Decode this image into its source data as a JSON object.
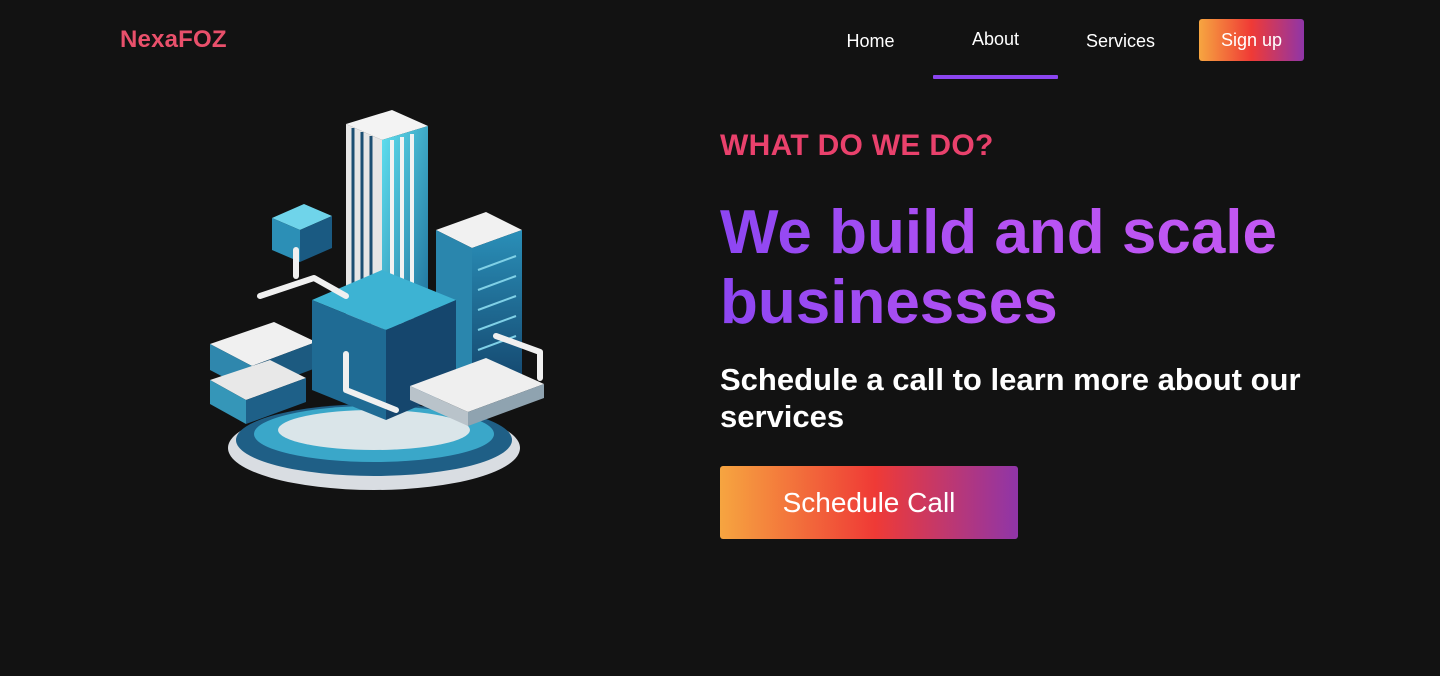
{
  "brand": {
    "name": "NexaFOZ",
    "color": "#e9506b"
  },
  "nav": {
    "items": [
      {
        "label": "Home",
        "active": false
      },
      {
        "label": "About",
        "active": true
      },
      {
        "label": "Services",
        "active": false
      }
    ],
    "signup_label": "Sign up",
    "active_indicator_color": "#8b45f0"
  },
  "hero": {
    "illustration_icon": "isometric-city-building-icon",
    "eyebrow": "WHAT DO WE DO?",
    "headline": "We build and scale businesses",
    "subheadline": "Schedule a call to learn more about our services",
    "cta_label": "Schedule Call"
  },
  "colors": {
    "background": "#121212",
    "eyebrow": "#e9416c",
    "headline_start": "#8d46f2",
    "headline_end": "#c85af2",
    "button_gradient": [
      "#f6a540",
      "#ef3a36",
      "#8f35a8"
    ]
  }
}
